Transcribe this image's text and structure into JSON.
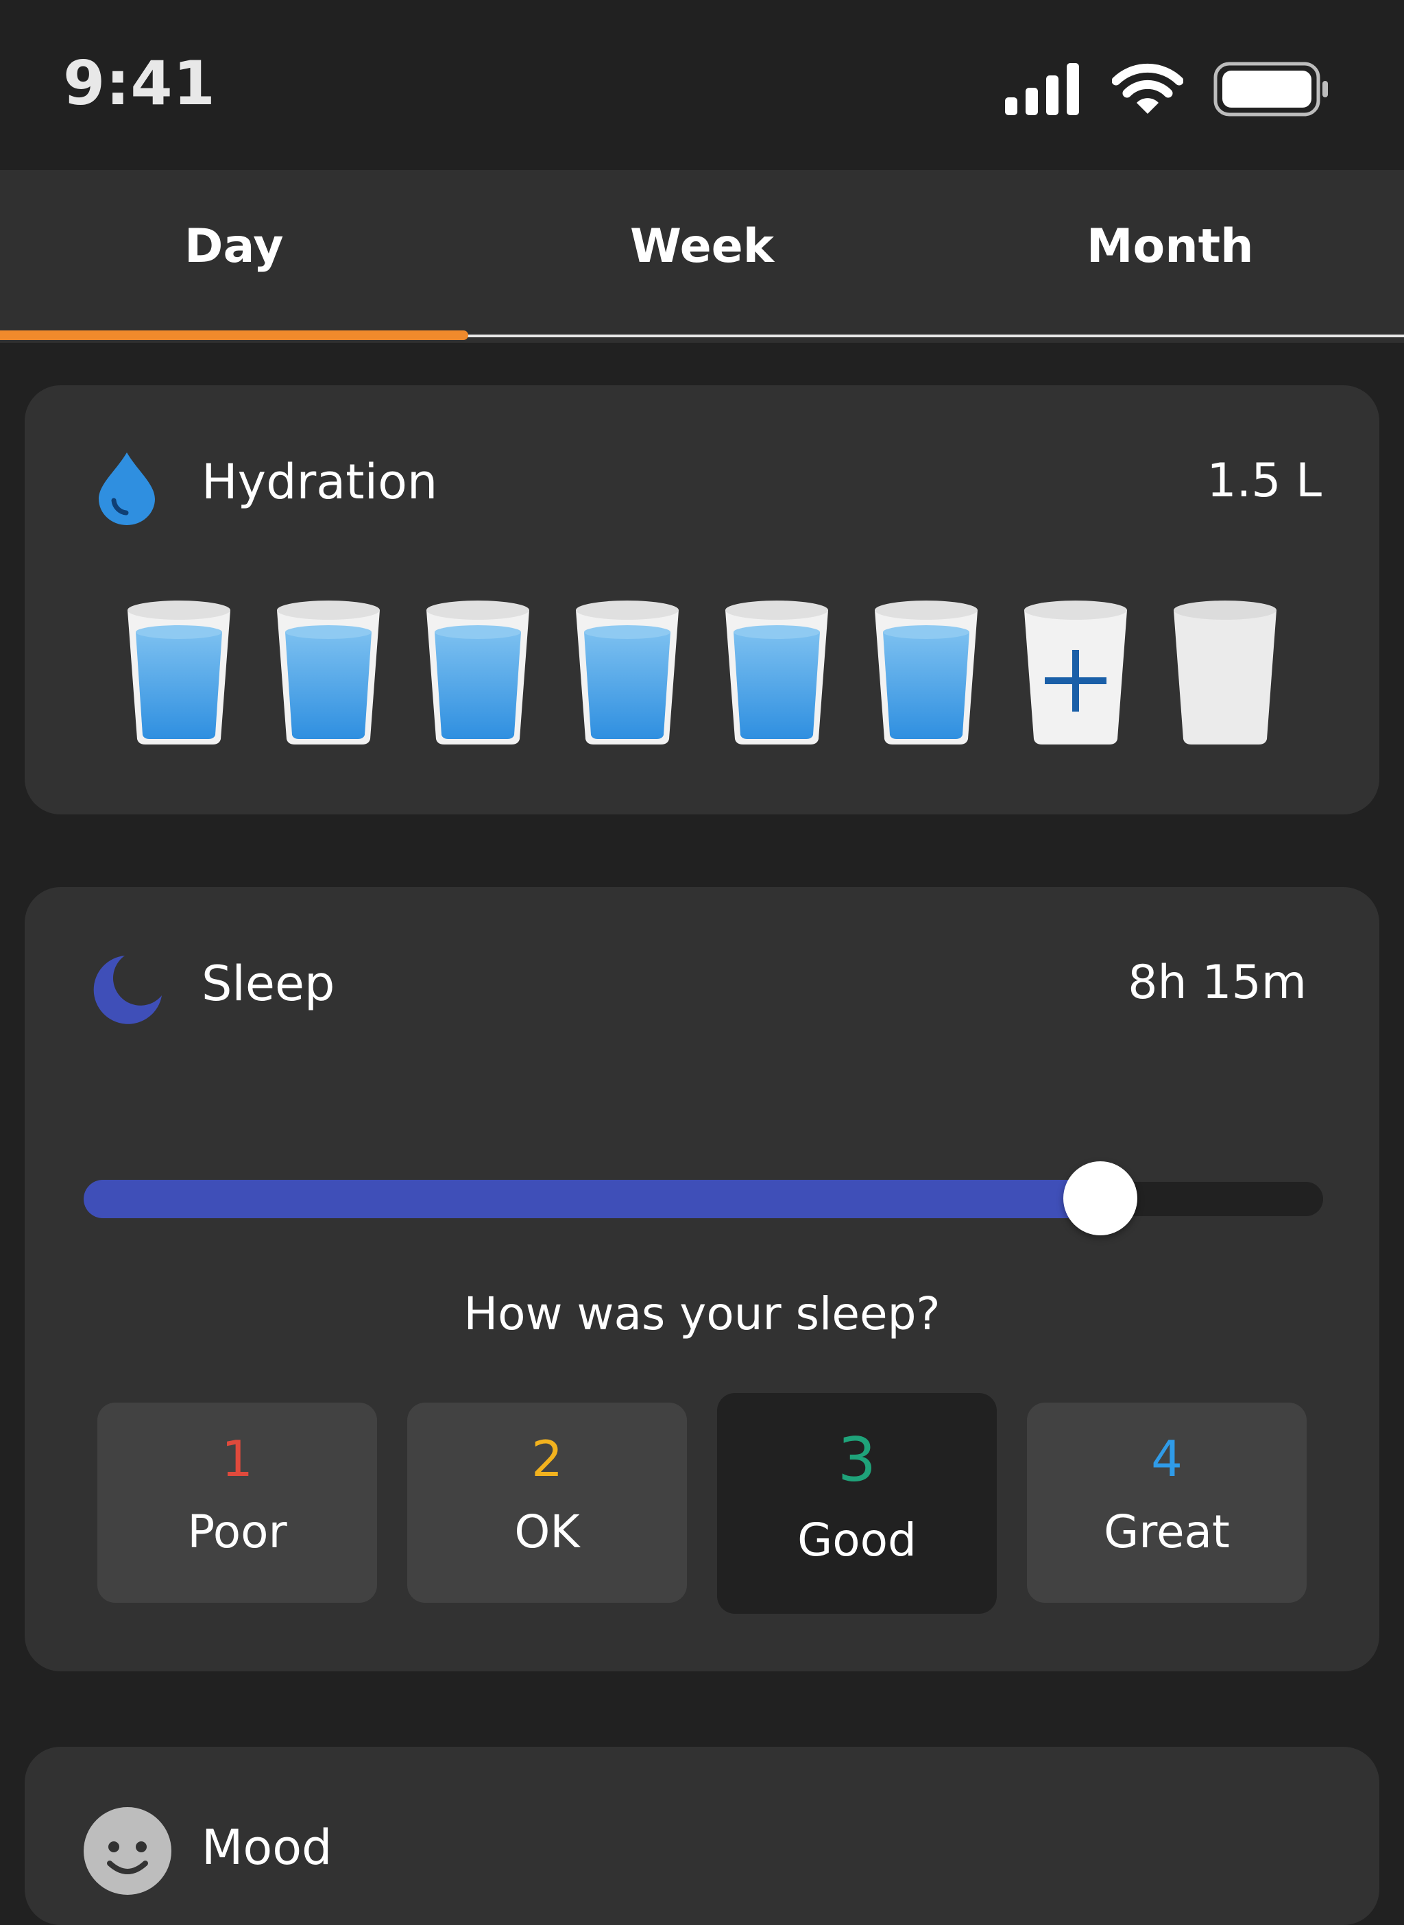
{
  "status_bar": {
    "time": "9:41"
  },
  "tabs": [
    {
      "label": "Day",
      "active": true
    },
    {
      "label": "Week",
      "active": false
    },
    {
      "label": "Month",
      "active": false
    }
  ],
  "colors": {
    "accent": "#f08a2c",
    "water": "#2f8fe0",
    "sleep": "#3f4fb8",
    "rating_1": "#e04a3c",
    "rating_2": "#f2b21e",
    "rating_3": "#1fa37a",
    "rating_4": "#2f9be8"
  },
  "hydration": {
    "title": "Hydration",
    "value": "1.5 L",
    "icon": "water-drop-icon",
    "glasses": [
      "full",
      "full",
      "full",
      "full",
      "full",
      "full",
      "add",
      "empty"
    ]
  },
  "sleep": {
    "title": "Sleep",
    "value": "8h 15m",
    "icon": "moon-icon",
    "slider_fraction": 0.82,
    "question": "How was your sleep?",
    "ratings": [
      {
        "number": "1",
        "label": "Poor",
        "selected": false
      },
      {
        "number": "2",
        "label": "OK",
        "selected": false
      },
      {
        "number": "3",
        "label": "Good",
        "selected": true
      },
      {
        "number": "4",
        "label": "Great",
        "selected": false
      }
    ]
  },
  "mood": {
    "title": "Mood",
    "icon": "smiley-face-icon"
  }
}
